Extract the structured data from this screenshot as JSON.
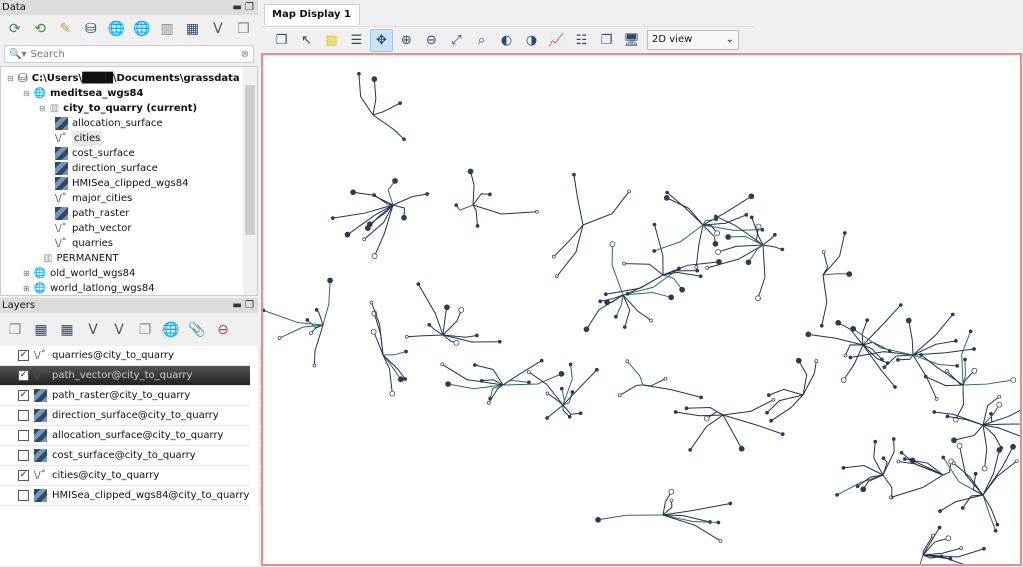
{
  "data_panel": {
    "title": "Data",
    "search_placeholder": "Search",
    "tree": [
      {
        "label": "C:\\Users\\████\\Documents\\grassdata",
        "type": "db",
        "indent": 0,
        "bold": true
      },
      {
        "label": "meditsea_wgs84",
        "type": "location",
        "indent": 1,
        "bold": true
      },
      {
        "label": "city_to_quarry  (current)",
        "type": "mapset",
        "indent": 2,
        "bold": true
      },
      {
        "label": "allocation_surface",
        "type": "raster",
        "indent": 3
      },
      {
        "label": "cities",
        "type": "vector",
        "indent": 3,
        "selected": true
      },
      {
        "label": "cost_surface",
        "type": "raster",
        "indent": 3
      },
      {
        "label": "direction_surface",
        "type": "raster",
        "indent": 3
      },
      {
        "label": "HMISea_clipped_wgs84",
        "type": "raster",
        "indent": 3
      },
      {
        "label": "major_cities",
        "type": "vector",
        "indent": 3
      },
      {
        "label": "path_raster",
        "type": "raster",
        "indent": 3
      },
      {
        "label": "path_vector",
        "type": "vector",
        "indent": 3
      },
      {
        "label": "quarries",
        "type": "vector",
        "indent": 3
      },
      {
        "label": "PERMANENT",
        "type": "mapset",
        "indent": 2
      },
      {
        "label": "old_world_wgs84",
        "type": "location",
        "indent": 1
      },
      {
        "label": "world_latlong_wgs84",
        "type": "location",
        "indent": 1
      }
    ]
  },
  "layers_panel": {
    "title": "Layers",
    "layers": [
      {
        "label": "quarries@city_to_quarry",
        "type": "vector",
        "checked": true
      },
      {
        "label": "path_vector@city_to_quarry",
        "type": "vector",
        "checked": true,
        "selected": true
      },
      {
        "label": "path_raster@city_to_quarry",
        "type": "raster",
        "checked": true
      },
      {
        "label": "direction_surface@city_to_quarry",
        "type": "raster",
        "checked": false
      },
      {
        "label": "allocation_surface@city_to_quarry",
        "type": "raster",
        "checked": false
      },
      {
        "label": "cost_surface@city_to_quarry",
        "type": "raster",
        "checked": false
      },
      {
        "label": "cities@city_to_quarry",
        "type": "vector",
        "checked": true
      },
      {
        "label": "HMISea_clipped_wgs84@city_to_quarry",
        "type": "raster",
        "checked": false
      }
    ]
  },
  "map_display": {
    "tab_label": "Map Display 1",
    "close": "×",
    "view_mode": "2D view",
    "active_tool": "pan"
  },
  "colors": {
    "accent": "#cce4f7",
    "map_border": "#f08a8a",
    "path": "#1f3350"
  }
}
